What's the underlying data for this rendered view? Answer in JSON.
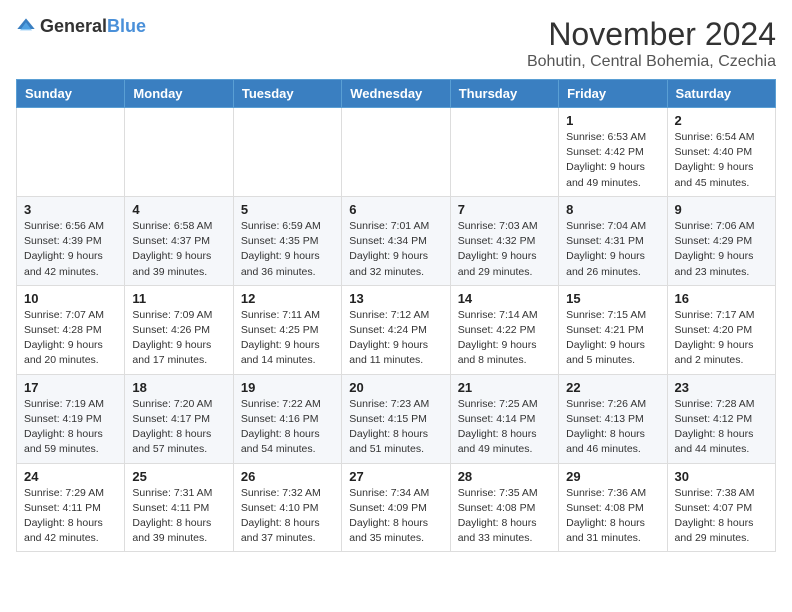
{
  "logo": {
    "text_general": "General",
    "text_blue": "Blue"
  },
  "title": "November 2024",
  "location": "Bohutin, Central Bohemia, Czechia",
  "days_of_week": [
    "Sunday",
    "Monday",
    "Tuesday",
    "Wednesday",
    "Thursday",
    "Friday",
    "Saturday"
  ],
  "weeks": [
    [
      {
        "day": "",
        "info": ""
      },
      {
        "day": "",
        "info": ""
      },
      {
        "day": "",
        "info": ""
      },
      {
        "day": "",
        "info": ""
      },
      {
        "day": "",
        "info": ""
      },
      {
        "day": "1",
        "info": "Sunrise: 6:53 AM\nSunset: 4:42 PM\nDaylight: 9 hours\nand 49 minutes."
      },
      {
        "day": "2",
        "info": "Sunrise: 6:54 AM\nSunset: 4:40 PM\nDaylight: 9 hours\nand 45 minutes."
      }
    ],
    [
      {
        "day": "3",
        "info": "Sunrise: 6:56 AM\nSunset: 4:39 PM\nDaylight: 9 hours\nand 42 minutes."
      },
      {
        "day": "4",
        "info": "Sunrise: 6:58 AM\nSunset: 4:37 PM\nDaylight: 9 hours\nand 39 minutes."
      },
      {
        "day": "5",
        "info": "Sunrise: 6:59 AM\nSunset: 4:35 PM\nDaylight: 9 hours\nand 36 minutes."
      },
      {
        "day": "6",
        "info": "Sunrise: 7:01 AM\nSunset: 4:34 PM\nDaylight: 9 hours\nand 32 minutes."
      },
      {
        "day": "7",
        "info": "Sunrise: 7:03 AM\nSunset: 4:32 PM\nDaylight: 9 hours\nand 29 minutes."
      },
      {
        "day": "8",
        "info": "Sunrise: 7:04 AM\nSunset: 4:31 PM\nDaylight: 9 hours\nand 26 minutes."
      },
      {
        "day": "9",
        "info": "Sunrise: 7:06 AM\nSunset: 4:29 PM\nDaylight: 9 hours\nand 23 minutes."
      }
    ],
    [
      {
        "day": "10",
        "info": "Sunrise: 7:07 AM\nSunset: 4:28 PM\nDaylight: 9 hours\nand 20 minutes."
      },
      {
        "day": "11",
        "info": "Sunrise: 7:09 AM\nSunset: 4:26 PM\nDaylight: 9 hours\nand 17 minutes."
      },
      {
        "day": "12",
        "info": "Sunrise: 7:11 AM\nSunset: 4:25 PM\nDaylight: 9 hours\nand 14 minutes."
      },
      {
        "day": "13",
        "info": "Sunrise: 7:12 AM\nSunset: 4:24 PM\nDaylight: 9 hours\nand 11 minutes."
      },
      {
        "day": "14",
        "info": "Sunrise: 7:14 AM\nSunset: 4:22 PM\nDaylight: 9 hours\nand 8 minutes."
      },
      {
        "day": "15",
        "info": "Sunrise: 7:15 AM\nSunset: 4:21 PM\nDaylight: 9 hours\nand 5 minutes."
      },
      {
        "day": "16",
        "info": "Sunrise: 7:17 AM\nSunset: 4:20 PM\nDaylight: 9 hours\nand 2 minutes."
      }
    ],
    [
      {
        "day": "17",
        "info": "Sunrise: 7:19 AM\nSunset: 4:19 PM\nDaylight: 8 hours\nand 59 minutes."
      },
      {
        "day": "18",
        "info": "Sunrise: 7:20 AM\nSunset: 4:17 PM\nDaylight: 8 hours\nand 57 minutes."
      },
      {
        "day": "19",
        "info": "Sunrise: 7:22 AM\nSunset: 4:16 PM\nDaylight: 8 hours\nand 54 minutes."
      },
      {
        "day": "20",
        "info": "Sunrise: 7:23 AM\nSunset: 4:15 PM\nDaylight: 8 hours\nand 51 minutes."
      },
      {
        "day": "21",
        "info": "Sunrise: 7:25 AM\nSunset: 4:14 PM\nDaylight: 8 hours\nand 49 minutes."
      },
      {
        "day": "22",
        "info": "Sunrise: 7:26 AM\nSunset: 4:13 PM\nDaylight: 8 hours\nand 46 minutes."
      },
      {
        "day": "23",
        "info": "Sunrise: 7:28 AM\nSunset: 4:12 PM\nDaylight: 8 hours\nand 44 minutes."
      }
    ],
    [
      {
        "day": "24",
        "info": "Sunrise: 7:29 AM\nSunset: 4:11 PM\nDaylight: 8 hours\nand 42 minutes."
      },
      {
        "day": "25",
        "info": "Sunrise: 7:31 AM\nSunset: 4:11 PM\nDaylight: 8 hours\nand 39 minutes."
      },
      {
        "day": "26",
        "info": "Sunrise: 7:32 AM\nSunset: 4:10 PM\nDaylight: 8 hours\nand 37 minutes."
      },
      {
        "day": "27",
        "info": "Sunrise: 7:34 AM\nSunset: 4:09 PM\nDaylight: 8 hours\nand 35 minutes."
      },
      {
        "day": "28",
        "info": "Sunrise: 7:35 AM\nSunset: 4:08 PM\nDaylight: 8 hours\nand 33 minutes."
      },
      {
        "day": "29",
        "info": "Sunrise: 7:36 AM\nSunset: 4:08 PM\nDaylight: 8 hours\nand 31 minutes."
      },
      {
        "day": "30",
        "info": "Sunrise: 7:38 AM\nSunset: 4:07 PM\nDaylight: 8 hours\nand 29 minutes."
      }
    ]
  ]
}
